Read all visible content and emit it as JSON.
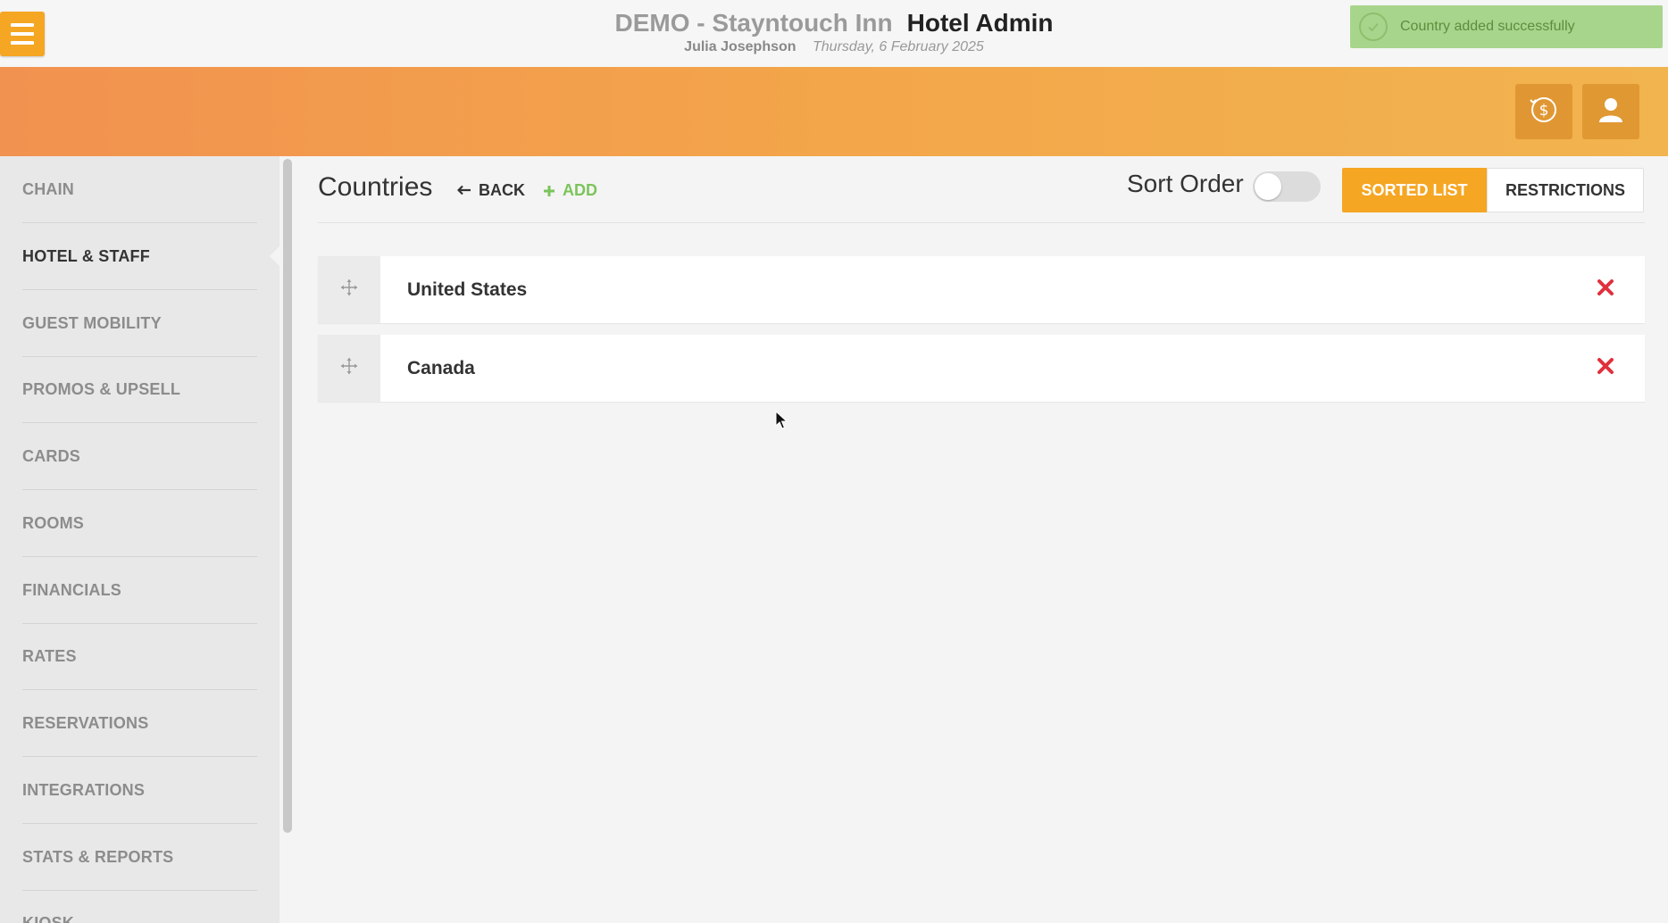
{
  "header": {
    "hotel_name": "DEMO - Stayntouch Inn",
    "app_title": "Hotel Admin",
    "user_name": "Julia Josephson",
    "date": "Thursday, 6 February 2025"
  },
  "toast": {
    "message": "Country added successfully",
    "color": "#a8d58c"
  },
  "toolbar_icons": [
    "currency-icon",
    "user-icon"
  ],
  "sidebar": {
    "items": [
      {
        "label": "CHAIN",
        "active": false
      },
      {
        "label": "HOTEL & STAFF",
        "active": true
      },
      {
        "label": "GUEST MOBILITY",
        "active": false
      },
      {
        "label": "PROMOS & UPSELL",
        "active": false
      },
      {
        "label": "CARDS",
        "active": false
      },
      {
        "label": "ROOMS",
        "active": false
      },
      {
        "label": "FINANCIALS",
        "active": false
      },
      {
        "label": "RATES",
        "active": false
      },
      {
        "label": "RESERVATIONS",
        "active": false
      },
      {
        "label": "INTEGRATIONS",
        "active": false
      },
      {
        "label": "STATS & REPORTS",
        "active": false
      },
      {
        "label": "KIOSK",
        "active": false
      }
    ]
  },
  "main": {
    "title": "Countries",
    "back_label": "BACK",
    "add_label": "ADD",
    "sort_order_label": "Sort Order",
    "sort_order_enabled": false,
    "tabs": [
      {
        "label": "SORTED LIST",
        "active": true
      },
      {
        "label": "RESTRICTIONS",
        "active": false
      }
    ],
    "countries": [
      {
        "name": "United States"
      },
      {
        "name": "Canada"
      }
    ]
  },
  "colors": {
    "accent": "#f5a623",
    "delete": "#e0303c",
    "add": "#7cc45a"
  }
}
